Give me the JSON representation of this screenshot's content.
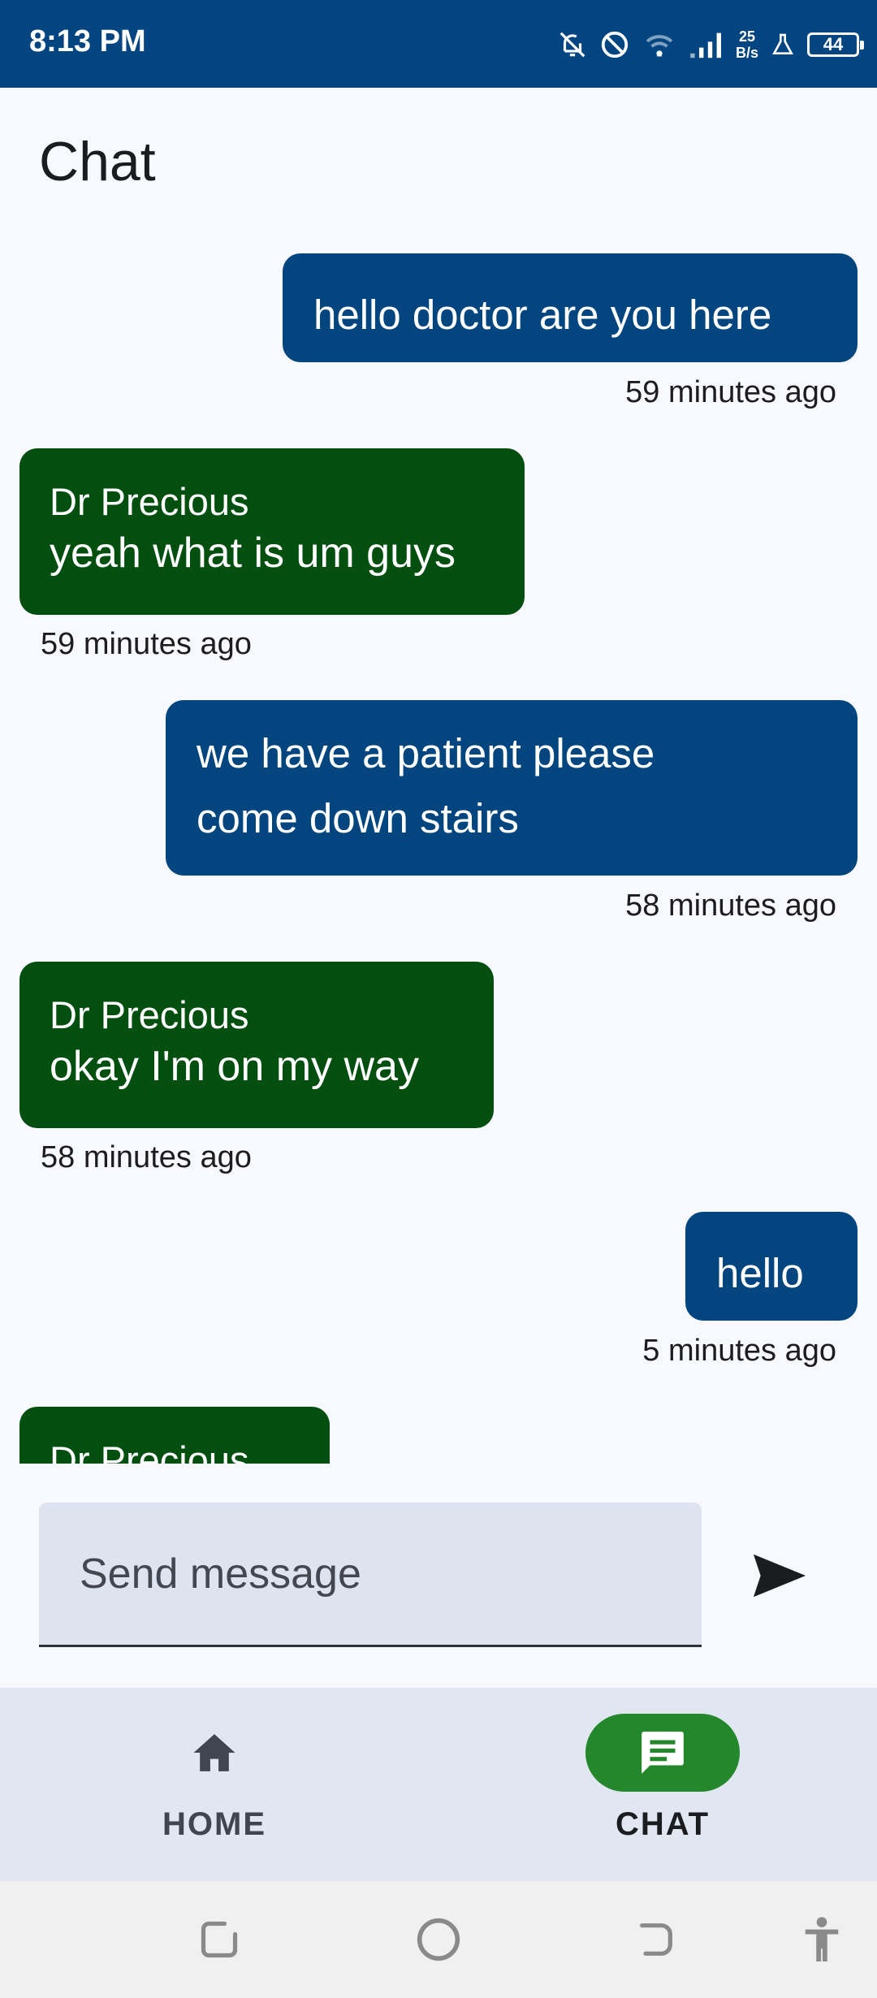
{
  "status_bar": {
    "time": "8:13 PM",
    "net_speed_value": "25",
    "net_speed_unit": "B/s",
    "battery": "44",
    "icons": [
      "notifications-off-icon",
      "do-not-disturb-icon",
      "wifi-icon",
      "signal-icon",
      "lab-flask-icon",
      "battery-icon"
    ]
  },
  "header": {
    "title": "Chat"
  },
  "messages": [
    {
      "direction": "sent",
      "text": "hello doctor are you here",
      "time": "59 minutes ago"
    },
    {
      "direction": "received",
      "sender": "Dr Precious",
      "text": "yeah what is um guys",
      "time": "59 minutes ago"
    },
    {
      "direction": "sent",
      "text_line1": "we have a patient please",
      "text_line2": "come down stairs",
      "time": "58 minutes ago"
    },
    {
      "direction": "received",
      "sender": "Dr Precious",
      "text": "okay I'm on my way",
      "time": "58 minutes ago"
    },
    {
      "direction": "sent",
      "text": "hello",
      "time": "5 minutes ago"
    },
    {
      "direction": "received",
      "sender": "Dr Precious",
      "text": ""
    }
  ],
  "composer": {
    "placeholder": "Send message",
    "value": ""
  },
  "bottom_nav": {
    "items": [
      {
        "label": "HOME",
        "icon": "home-icon",
        "active": false
      },
      {
        "label": "CHAT",
        "icon": "chat-icon",
        "active": true
      }
    ]
  },
  "system_nav": {
    "buttons": [
      "recents-icon",
      "home-circle-icon",
      "back-icon",
      "accessibility-icon"
    ]
  },
  "colors": {
    "status_bar": "#034580",
    "sent_bubble": "#03467f",
    "received_bubble": "#024f0f",
    "active_nav_pill": "#24872c",
    "background": "#f7f9fe"
  }
}
